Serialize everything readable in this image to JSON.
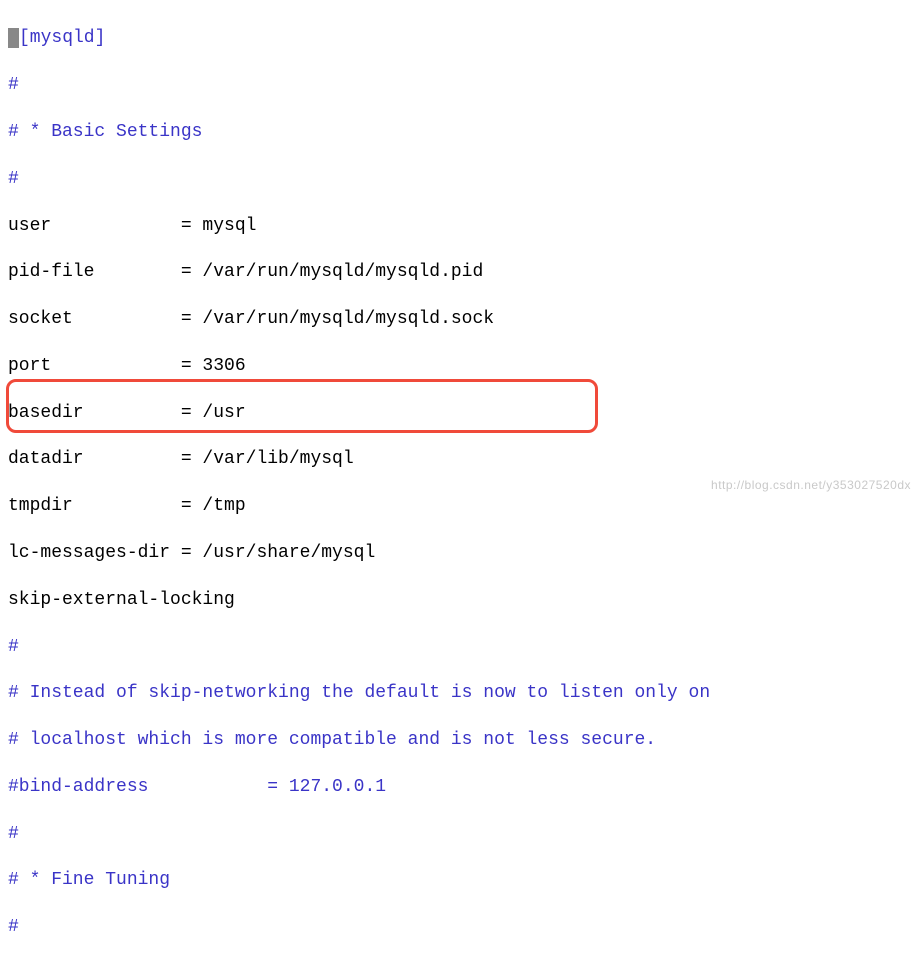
{
  "config": {
    "section_header": "[mysqld]",
    "hash1": "#",
    "basic_settings": "# * Basic Settings",
    "hash2": "#",
    "user": "user            = mysql",
    "pid_file": "pid-file        = /var/run/mysqld/mysqld.pid",
    "socket": "socket          = /var/run/mysqld/mysqld.sock",
    "port": "port            = 3306",
    "basedir": "basedir         = /usr",
    "datadir": "datadir         = /var/lib/mysql",
    "tmpdir": "tmpdir          = /tmp",
    "lc_messages_dir": "lc-messages-dir = /usr/share/mysql",
    "skip_ext_lock": "skip-external-locking",
    "hash3": "#",
    "comment_skip1": "# Instead of skip-networking the default is now to listen only on",
    "comment_skip2": "# localhost which is more compatible and is not less secure.",
    "bind_address": "#bind-address           = 127.0.0.1",
    "hash4": "#",
    "fine_tuning": "# * Fine Tuning",
    "hash5": "#"
  },
  "watermark": "http://blog.csdn.net/y353027520dx"
}
